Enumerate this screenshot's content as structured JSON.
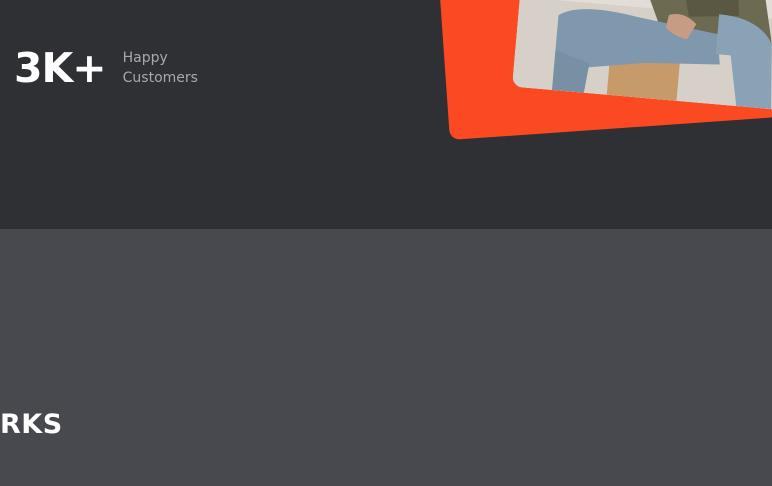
{
  "stats": {
    "value": "3K+",
    "label_line1": "Happy",
    "label_line2": "Customers"
  },
  "section": {
    "title": "RKS"
  },
  "colors": {
    "background_dark": "#2f3034",
    "background_section": "#48494e",
    "accent": "#fb4a22",
    "text_primary": "#ffffff",
    "text_muted": "#a7a8ad"
  }
}
